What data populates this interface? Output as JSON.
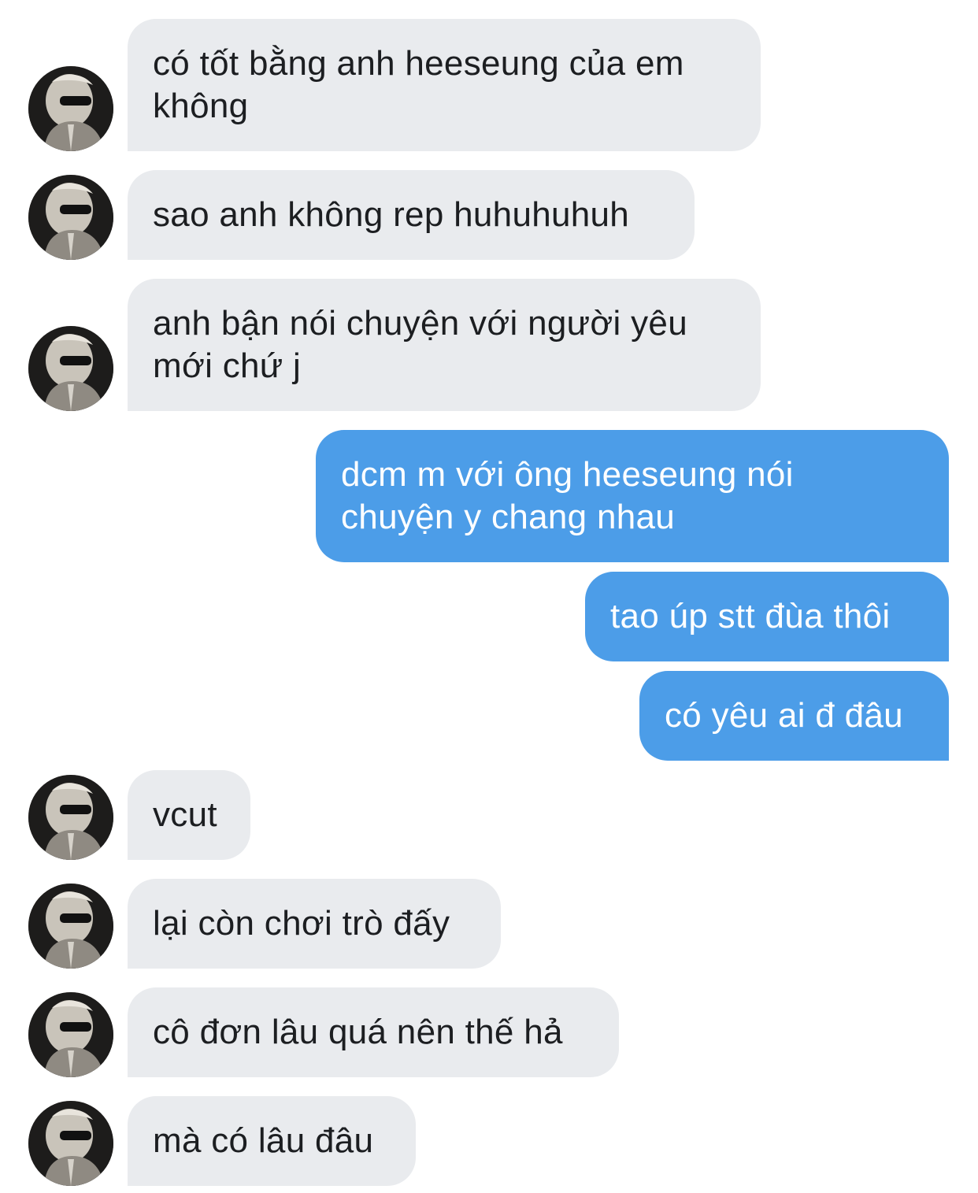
{
  "conversation": {
    "messages": [
      {
        "direction": "in",
        "lines": [
          "có tốt bằng anh heeseung của em",
          "không"
        ],
        "show_avatar": true
      },
      {
        "direction": "in",
        "lines": [
          "sao anh không rep huhuhuhuh"
        ],
        "show_avatar": true
      },
      {
        "direction": "in",
        "lines": [
          "anh bận nói chuyện với người yêu",
          "mới chứ j"
        ],
        "show_avatar": true
      },
      {
        "direction": "out",
        "lines": [
          "dcm m với ông heeseung nói",
          "chuyện y chang nhau"
        ]
      },
      {
        "direction": "out",
        "lines": [
          "tao úp stt đùa thôi"
        ]
      },
      {
        "direction": "out",
        "lines": [
          "có yêu ai đ đâu"
        ]
      },
      {
        "direction": "in",
        "lines": [
          "vcut"
        ],
        "show_avatar": true
      },
      {
        "direction": "in",
        "lines": [
          "lại còn chơi trò đấy"
        ],
        "show_avatar": true
      },
      {
        "direction": "in",
        "lines": [
          "cô đơn lâu quá nên thế hả"
        ],
        "show_avatar": true
      },
      {
        "direction": "in",
        "lines": [
          "mà có lâu đâu"
        ],
        "show_avatar": true
      }
    ]
  },
  "colors": {
    "incoming_bubble": "#e9ebee",
    "incoming_text": "#1c1e21",
    "outgoing_bubble": "#4c9de8",
    "outgoing_text": "#ffffff",
    "background": "#ffffff"
  },
  "icons": {
    "avatar": "contact-avatar-photo"
  }
}
